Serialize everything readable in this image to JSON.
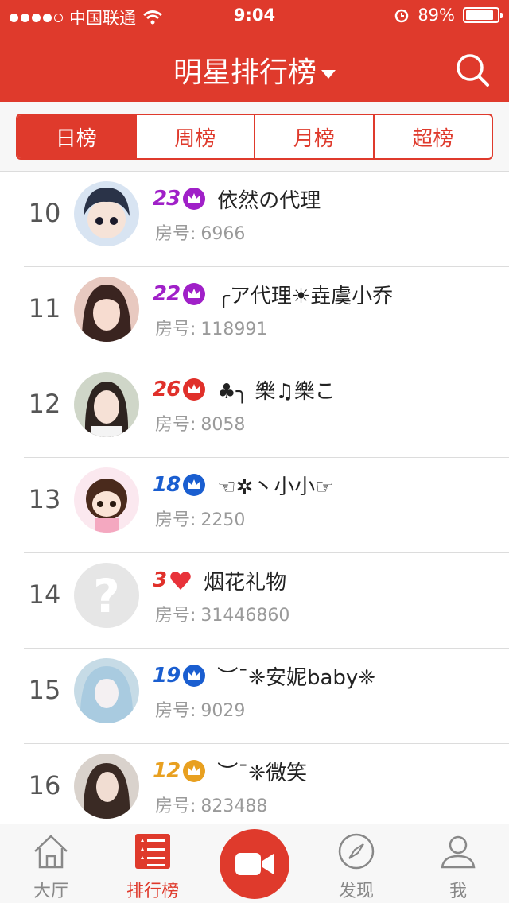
{
  "status_bar": {
    "carrier": "中国联通",
    "time": "9:04",
    "battery_percent": "89%",
    "battery_level": 0.89,
    "signal_dots_filled": 4,
    "signal_dots_total": 5
  },
  "header": {
    "title": "明星排行榜",
    "icons": [
      "dropdown-caret-icon",
      "search-icon"
    ],
    "color": "#df3a2c"
  },
  "tabs": [
    {
      "label": "日榜",
      "active": true
    },
    {
      "label": "周榜",
      "active": false
    },
    {
      "label": "月榜",
      "active": false
    },
    {
      "label": "超榜",
      "active": false
    }
  ],
  "room_label": "房号:",
  "ranking": [
    {
      "rank": "10",
      "level": "23",
      "badge": "crown",
      "color": "#a020c8",
      "name": "依然の代理",
      "room": "6966"
    },
    {
      "rank": "11",
      "level": "22",
      "badge": "crown",
      "color": "#a020c8",
      "name": "╭ア代理☀垚虞小乔",
      "room": "118991"
    },
    {
      "rank": "12",
      "level": "26",
      "badge": "crown",
      "color": "#e0302a",
      "name": "♣╮ 樂♫樂こ",
      "room": "8058"
    },
    {
      "rank": "13",
      "level": "18",
      "badge": "crown",
      "color": "#1a5ed0",
      "name": "☜✲丶小小☞",
      "room": "2250"
    },
    {
      "rank": "14",
      "level": "3",
      "badge": "heart",
      "color": "#e0302a",
      "name": "烟花礼物",
      "room": "31446860"
    },
    {
      "rank": "15",
      "level": "19",
      "badge": "crown",
      "color": "#1a5ed0",
      "name": "︶¯❈安妮baby❈",
      "room": "9029"
    },
    {
      "rank": "16",
      "level": "12",
      "badge": "crown",
      "color": "#e8a020",
      "name": "︶¯❈微笑",
      "room": "823488"
    }
  ],
  "tabbar": [
    {
      "label": "大厅",
      "icon": "home-icon",
      "active": false
    },
    {
      "label": "排行榜",
      "icon": "ranking-list-icon",
      "active": true
    },
    {
      "label": "",
      "icon": "video-camera-icon",
      "active": false
    },
    {
      "label": "发现",
      "icon": "compass-icon",
      "active": false
    },
    {
      "label": "我",
      "icon": "user-icon",
      "active": false
    }
  ]
}
